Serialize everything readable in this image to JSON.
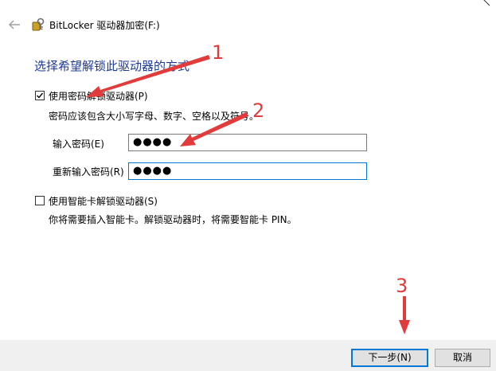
{
  "window": {
    "title": "BitLocker 驱动器加密(F:)"
  },
  "main": {
    "heading": "选择希望解锁此驱动器的方式",
    "option_password": {
      "label": "使用密码解锁驱动器(P)",
      "checked": true,
      "hint": "密码应该包含大小写字母、数字、空格以及符号。",
      "enter_label": "输入密码(E)",
      "enter_value": "●●●●",
      "reenter_label": "重新输入密码(R)",
      "reenter_value": "●●●●"
    },
    "option_smartcard": {
      "label": "使用智能卡解锁驱动器(S)",
      "checked": false,
      "hint": "你将需要插入智能卡。解锁驱动器时，将需要智能卡 PIN。"
    }
  },
  "footer": {
    "next_label": "下一步(N)",
    "cancel_label": "取消"
  },
  "annotations": {
    "step1": "1",
    "step2": "2",
    "step3": "3",
    "color": "#e23b3b"
  },
  "colors": {
    "heading": "#1f3a93",
    "focus_border": "#0078d7",
    "footer_bg": "#f0f0f0"
  },
  "icons": {
    "back": "back-arrow-icon",
    "app": "bitlocker-key-icon",
    "close": "close-icon"
  }
}
